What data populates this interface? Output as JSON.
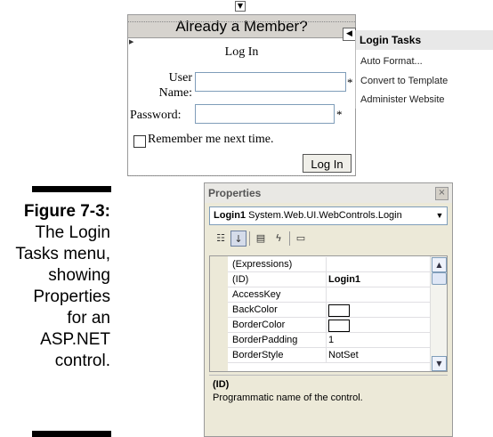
{
  "figure": {
    "label": "Figure 7-3:",
    "caption_lines": [
      "The Login",
      "Tasks menu,",
      "showing",
      "Properties",
      "for an",
      "ASP.NET",
      "control."
    ]
  },
  "login_control": {
    "header": "Already a Member?",
    "title": "Log In",
    "user_label_1": "User",
    "user_label_2": "Name:",
    "password_label": "Password:",
    "required_marker": "*",
    "remember_label": "Remember me next time.",
    "button_label": "Log In"
  },
  "tasks_panel": {
    "title": "Login Tasks",
    "items": [
      "Auto Format...",
      "Convert to Template",
      "Administer Website"
    ]
  },
  "properties": {
    "title": "Properties",
    "close_glyph": "×",
    "object_name": "Login1",
    "object_type": "System.Web.UI.WebControls.Login",
    "rows": [
      {
        "name": "(Expressions)",
        "value": ""
      },
      {
        "name": "(ID)",
        "value": "Login1"
      },
      {
        "name": "AccessKey",
        "value": ""
      },
      {
        "name": "BackColor",
        "value": ""
      },
      {
        "name": "BorderColor",
        "value": ""
      },
      {
        "name": "BorderPadding",
        "value": "1"
      },
      {
        "name": "BorderStyle",
        "value": "NotSet"
      }
    ],
    "description_title": "(ID)",
    "description_text": "Programmatic name of the control."
  }
}
